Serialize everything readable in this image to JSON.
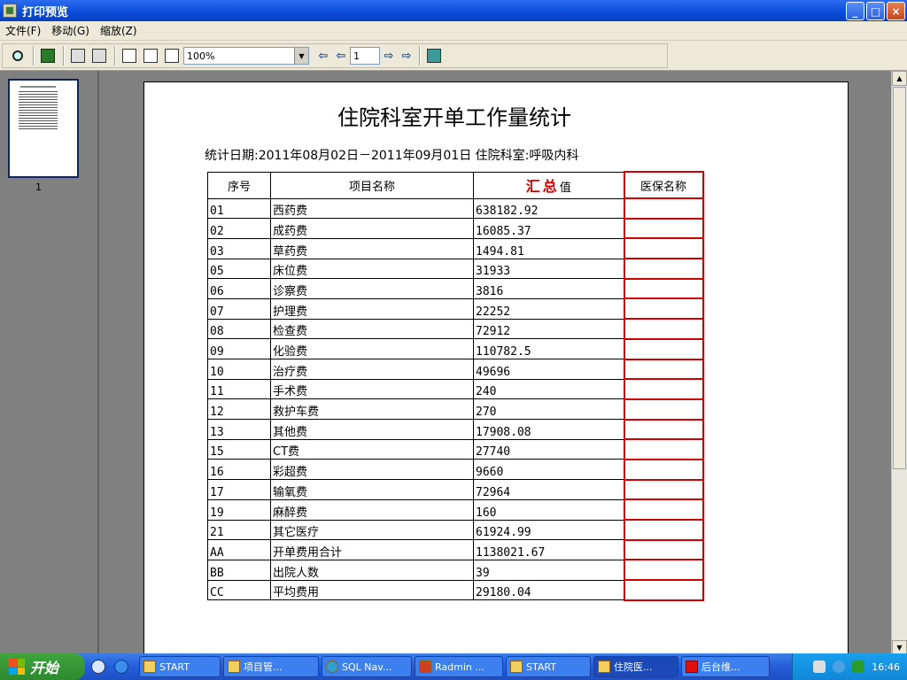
{
  "window": {
    "title": "打印预览",
    "buttons": [
      "_",
      "□",
      "×"
    ]
  },
  "menu": [
    {
      "label": "文件(F)"
    },
    {
      "label": "移动(G)"
    },
    {
      "label": "缩放(Z)"
    }
  ],
  "toolbar": {
    "zoom_value": "100%",
    "page_value": "1"
  },
  "thumbnails": [
    {
      "label": "1"
    }
  ],
  "report": {
    "title": "住院科室开单工作量统计",
    "meta": "统计日期:2011年08月02日－2011年09月01日 住院科室:呼吸内科",
    "headers": {
      "seq": "序号",
      "name": "项目名称",
      "sum_red": "汇总",
      "sum_suffix": "值",
      "med": "医保名称"
    },
    "rows": [
      {
        "seq": "01",
        "name": "西药费",
        "value": "638182.92",
        "med": ""
      },
      {
        "seq": "02",
        "name": "成药费",
        "value": "16085.37",
        "med": ""
      },
      {
        "seq": "03",
        "name": "草药费",
        "value": "1494.81",
        "med": ""
      },
      {
        "seq": "05",
        "name": "床位费",
        "value": "31933",
        "med": ""
      },
      {
        "seq": "06",
        "name": "诊察费",
        "value": "3816",
        "med": ""
      },
      {
        "seq": "07",
        "name": "护理费",
        "value": "22252",
        "med": ""
      },
      {
        "seq": "08",
        "name": "检查费",
        "value": "72912",
        "med": ""
      },
      {
        "seq": "09",
        "name": "化验费",
        "value": "110782.5",
        "med": ""
      },
      {
        "seq": "10",
        "name": "治疗费",
        "value": "49696",
        "med": ""
      },
      {
        "seq": "11",
        "name": "手术费",
        "value": "240",
        "med": ""
      },
      {
        "seq": "12",
        "name": "救护车费",
        "value": "270",
        "med": ""
      },
      {
        "seq": "13",
        "name": "其他费",
        "value": "17908.08",
        "med": ""
      },
      {
        "seq": "15",
        "name": "CT费",
        "value": "27740",
        "med": ""
      },
      {
        "seq": "16",
        "name": "彩超费",
        "value": "9660",
        "med": ""
      },
      {
        "seq": "17",
        "name": "输氧费",
        "value": "72964",
        "med": ""
      },
      {
        "seq": "19",
        "name": "麻醉费",
        "value": "160",
        "med": ""
      },
      {
        "seq": "21",
        "name": "其它医疗",
        "value": "61924.99",
        "med": ""
      },
      {
        "seq": "AA",
        "name": "开单费用合计",
        "value": "1138021.67",
        "med": ""
      },
      {
        "seq": "BB",
        "name": "出院人数",
        "value": "39",
        "med": ""
      },
      {
        "seq": "CC",
        "name": "平均费用",
        "value": "29180.04",
        "med": ""
      }
    ]
  },
  "taskbar": {
    "start_label": "开始",
    "tasks": [
      {
        "label": "START",
        "icon": "folder-icon"
      },
      {
        "label": "项目管...",
        "icon": "app-icon"
      },
      {
        "label": "SQL Nav...",
        "icon": "database-icon"
      },
      {
        "label": "Radmin ...",
        "icon": "radmin-icon"
      },
      {
        "label": "START",
        "icon": "folder-icon"
      },
      {
        "label": "住院医...",
        "icon": "app-icon"
      },
      {
        "label": "后台维...",
        "icon": "red-cross-icon"
      }
    ],
    "clock": "16:46"
  },
  "colors": {
    "accent_red": "#d00000",
    "titlebar_blue": "#0a4bd6",
    "taskbar_blue": "#245ddb",
    "start_green": "#3ea53e"
  }
}
